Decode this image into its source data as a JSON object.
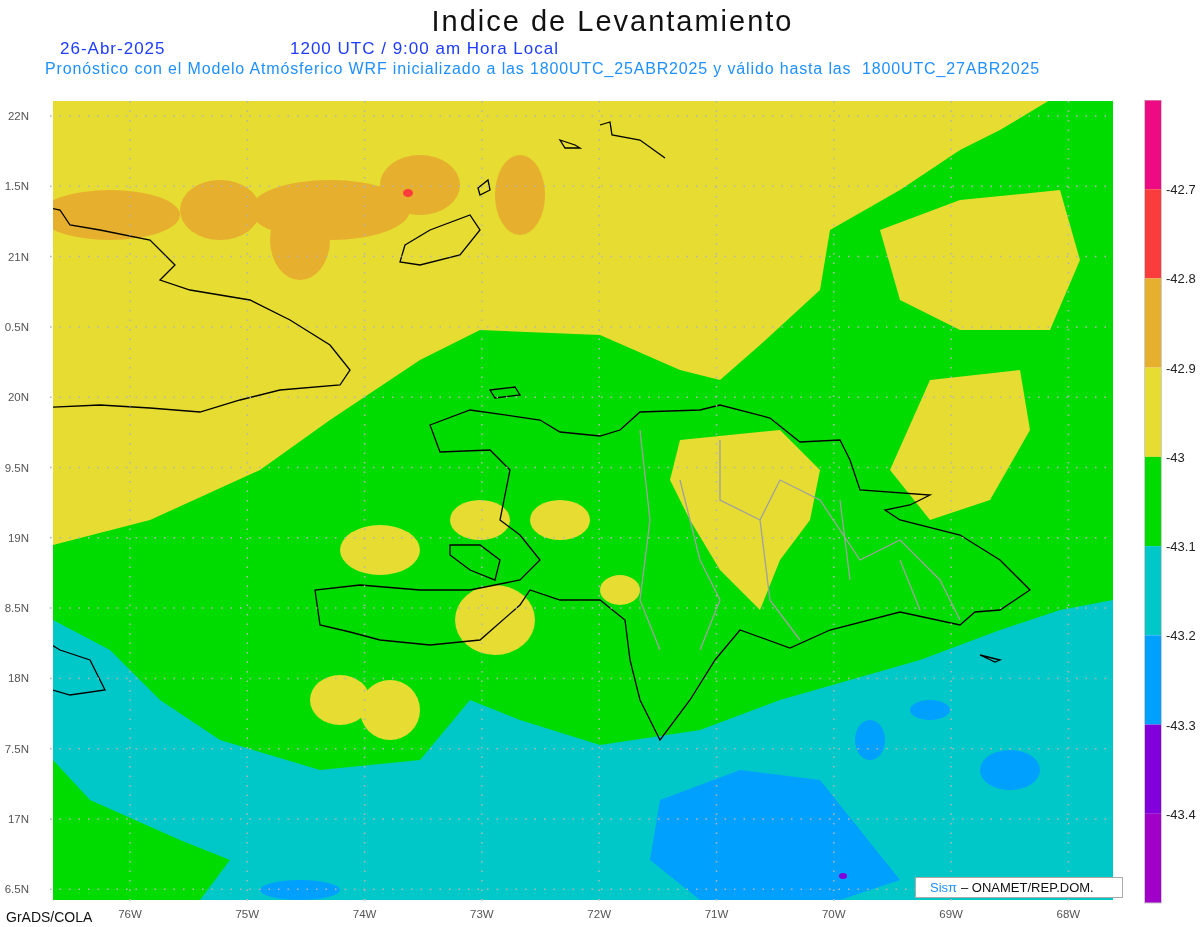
{
  "title": "Indice de Levantamiento",
  "date": "26-Abr-2025",
  "time": "1200 UTC / 9:00 am Hora Local",
  "subtitle": "Pronóstico con el Modelo Atmósferico WRF inicializado a las 1800UTC_25ABR2025 y válido hasta las  1800UTC_27ABR2025",
  "lat_labels": [
    "22N",
    "1.5N",
    "21N",
    "0.5N",
    "20N",
    "9.5N",
    "19N",
    "8.5N",
    "18N",
    "7.5N",
    "17N",
    "6.5N"
  ],
  "lon_labels": [
    "76W",
    "75W",
    "74W",
    "73W",
    "72W",
    "71W",
    "70W",
    "69W",
    "68W"
  ],
  "colorbar": {
    "segments": [
      {
        "color": "#ee0a82"
      },
      {
        "color": "#fa3c3c"
      },
      {
        "color": "#e6af2d"
      },
      {
        "color": "#e6dc32"
      },
      {
        "color": "#00dc00"
      },
      {
        "color": "#00c8c8"
      },
      {
        "color": "#00a0ff"
      },
      {
        "color": "#8200dc"
      },
      {
        "color": "#a000c8"
      }
    ],
    "labels": [
      "-42.7",
      "-42.8",
      "-42.9",
      "-43",
      "-43.1",
      "-43.2",
      "-43.3",
      "-43.4"
    ]
  },
  "credit": {
    "logo": "Sisπ",
    "text": "– ONAMET/REP.DOM."
  },
  "footer": "GrADS/COLA"
}
